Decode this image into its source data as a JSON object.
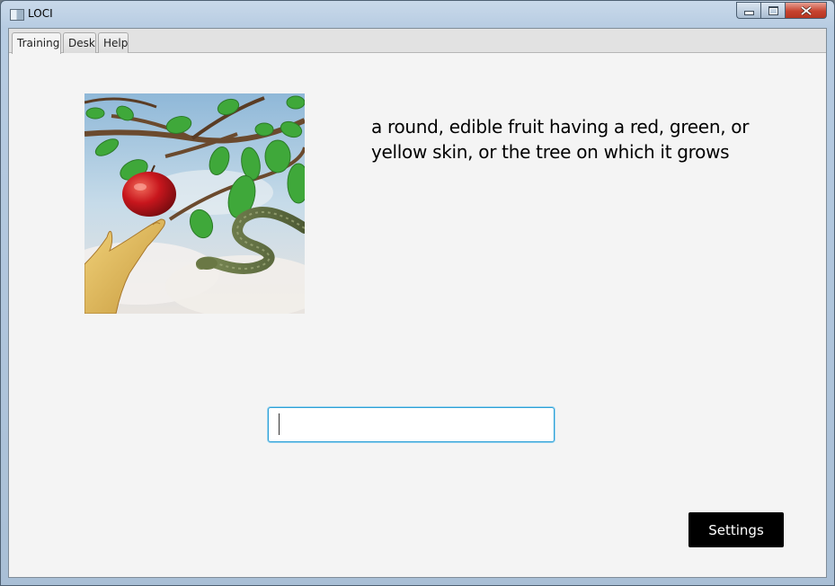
{
  "window": {
    "title": "LOCI"
  },
  "tabs": [
    {
      "label": "Training",
      "active": true
    },
    {
      "label": "Desk",
      "active": false
    },
    {
      "label": "Help",
      "active": false
    }
  ],
  "training": {
    "definition": "a round, edible fruit having a red, green, or yellow skin, or the tree on which it grows",
    "answer_value": "",
    "settings_label": "Settings"
  },
  "colors": {
    "input_focus": "#2b9fd6",
    "button_bg": "#000000",
    "apple_red": "#c8161d",
    "leaf_green": "#3fa83a"
  }
}
